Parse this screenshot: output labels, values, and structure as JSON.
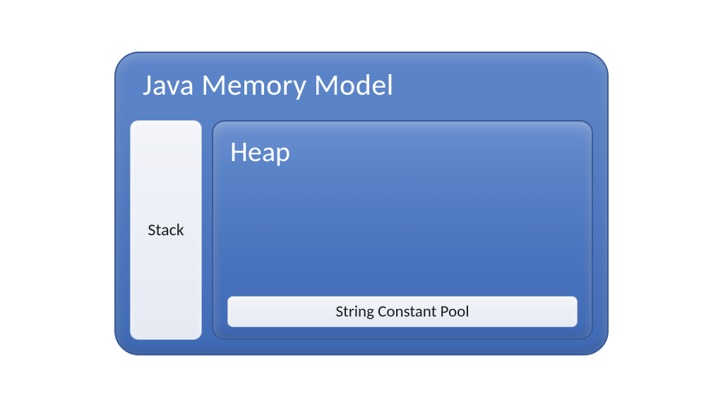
{
  "diagram": {
    "title": "Java Memory Model",
    "stack": {
      "label": "Stack"
    },
    "heap": {
      "label": "Heap",
      "string_constant_pool": {
        "label": "String Constant Pool"
      }
    }
  },
  "colors": {
    "container_blue_top": "#5b84c8",
    "container_blue_bottom": "#3f6ab5",
    "inner_box_light": "#f2f4f9",
    "border_blue": "#3a5a9a",
    "text_white": "#ffffff",
    "text_dark": "#1a1a1a"
  }
}
